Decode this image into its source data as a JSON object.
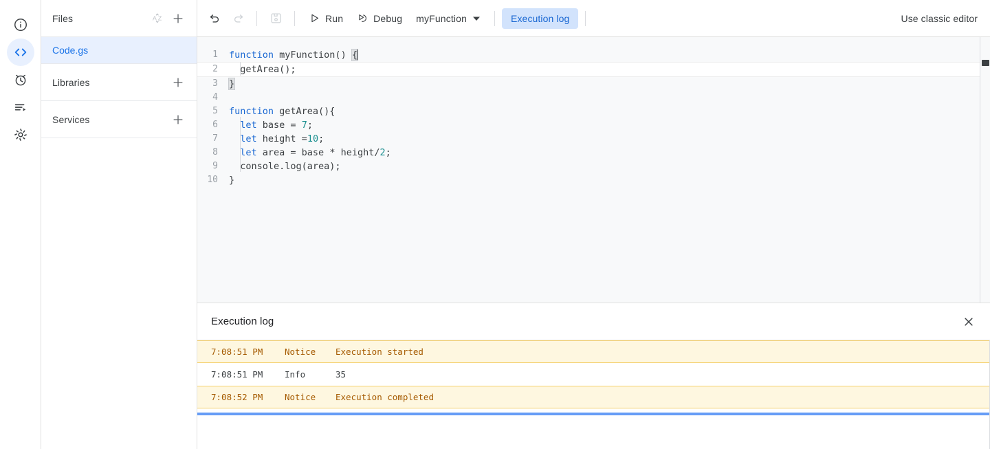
{
  "rail": {
    "items": [
      {
        "name": "project-overview",
        "icon": "info-icon",
        "active": false
      },
      {
        "name": "editor",
        "icon": "code-brackets-icon",
        "active": true
      },
      {
        "name": "triggers",
        "icon": "alarm-clock-icon",
        "active": false
      },
      {
        "name": "executions",
        "icon": "executions-list-icon",
        "active": false
      },
      {
        "name": "project-settings",
        "icon": "gear-icon",
        "active": false
      }
    ]
  },
  "sidebar": {
    "files": {
      "title": "Files",
      "sort_icon": "sort-az-icon",
      "add_icon": "plus-icon",
      "items": [
        {
          "label": "Code.gs",
          "selected": true
        }
      ]
    },
    "libraries": {
      "title": "Libraries",
      "add_icon": "plus-icon"
    },
    "services": {
      "title": "Services",
      "add_icon": "plus-icon"
    }
  },
  "toolbar": {
    "undo": {
      "label": "Undo",
      "icon": "undo-icon",
      "disabled": false
    },
    "redo": {
      "label": "Redo",
      "icon": "redo-icon",
      "disabled": true
    },
    "save": {
      "label": "Save project",
      "icon": "save-floppy-icon",
      "disabled": true
    },
    "run": {
      "label": "Run",
      "icon": "play-triangle-icon"
    },
    "debug": {
      "label": "Debug",
      "icon": "debug-icon"
    },
    "function_select": {
      "value": "myFunction",
      "icon": "chevron-down-icon"
    },
    "execution_log": {
      "label": "Execution log",
      "active": true
    },
    "classic_editor": {
      "label": "Use classic editor"
    }
  },
  "editor": {
    "lines": [
      {
        "number": "1",
        "active": false,
        "tokens": [
          {
            "t": "function",
            "c": "kw"
          },
          {
            "t": " myFunction() ",
            "c": ""
          },
          {
            "t": "{",
            "c": "brace-hl"
          }
        ],
        "caret_after": true
      },
      {
        "number": "2",
        "active": true,
        "tokens": [
          {
            "t": "  getArea();",
            "c": ""
          }
        ],
        "caret_after": false
      },
      {
        "number": "3",
        "active": false,
        "tokens": [
          {
            "t": "}",
            "c": "brace-hl"
          }
        ],
        "caret_after": false
      },
      {
        "number": "4",
        "active": false,
        "tokens": [],
        "caret_after": false
      },
      {
        "number": "5",
        "active": false,
        "tokens": [
          {
            "t": "function",
            "c": "kw"
          },
          {
            "t": " getArea(){",
            "c": ""
          }
        ],
        "caret_after": false
      },
      {
        "number": "6",
        "active": false,
        "tokens": [
          {
            "t": "  ",
            "c": ""
          },
          {
            "t": "let",
            "c": "kw"
          },
          {
            "t": " base = ",
            "c": ""
          },
          {
            "t": "7",
            "c": "num"
          },
          {
            "t": ";",
            "c": ""
          }
        ],
        "caret_after": false
      },
      {
        "number": "7",
        "active": false,
        "tokens": [
          {
            "t": "  ",
            "c": ""
          },
          {
            "t": "let",
            "c": "kw"
          },
          {
            "t": " height =",
            "c": ""
          },
          {
            "t": "10",
            "c": "num"
          },
          {
            "t": ";",
            "c": ""
          }
        ],
        "caret_after": false
      },
      {
        "number": "8",
        "active": false,
        "tokens": [
          {
            "t": "  ",
            "c": ""
          },
          {
            "t": "let",
            "c": "kw"
          },
          {
            "t": " area = base * height/",
            "c": ""
          },
          {
            "t": "2",
            "c": "num"
          },
          {
            "t": ";",
            "c": ""
          }
        ],
        "caret_after": false
      },
      {
        "number": "9",
        "active": false,
        "tokens": [
          {
            "t": "  console.log(area);",
            "c": ""
          }
        ],
        "caret_after": false
      },
      {
        "number": "10",
        "active": false,
        "tokens": [
          {
            "t": "}",
            "c": ""
          }
        ],
        "caret_after": false
      }
    ]
  },
  "execution_log": {
    "title": "Execution log",
    "close_icon": "close-x-icon",
    "columns": [
      "time",
      "level",
      "message"
    ],
    "rows": [
      {
        "time": "7:08:51 PM",
        "level": "Notice",
        "message": "Execution started",
        "type": "notice"
      },
      {
        "time": "7:08:51 PM",
        "level": "Info",
        "message": "35",
        "type": "info"
      },
      {
        "time": "7:08:52 PM",
        "level": "Notice",
        "message": "Execution completed",
        "type": "notice"
      }
    ]
  },
  "colors": {
    "accent_blue": "#1a73e8",
    "pill_bg": "#d2e3fc",
    "selected_bg": "#e8f0fe",
    "notice_bg": "#fef7e0",
    "notice_text": "#a55a00",
    "notice_border": "#f4cf6a",
    "editor_bg": "#f8f9fa",
    "progress_bar": "#669df6"
  }
}
